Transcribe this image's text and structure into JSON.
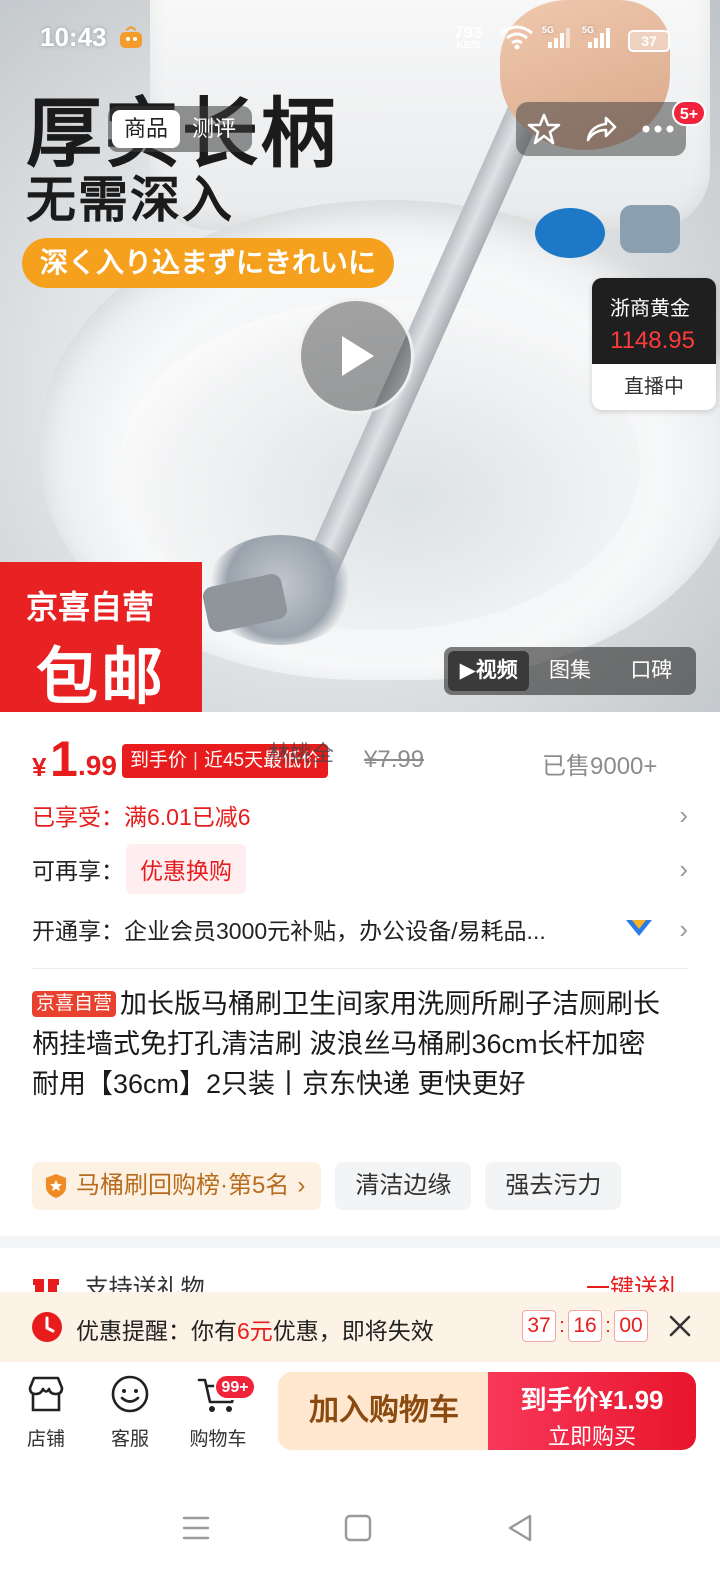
{
  "status_bar": {
    "time": "10:43",
    "net_speed_value": "793",
    "net_speed_unit": "KB/S",
    "battery": "37"
  },
  "hero": {
    "headline_1": "厚实长柄",
    "headline_2": "无需深入",
    "jp_tagline": "深く入り込まずにきれいに",
    "tabs": [
      {
        "label": "商品",
        "active": true
      },
      {
        "label": "测评",
        "active": false
      }
    ],
    "more_badge": "5+",
    "live_card": {
      "name": "浙商黄金",
      "price": "1148.95",
      "status": "直播中"
    },
    "promo_line_1": "京喜自营",
    "promo_line_2": "包邮",
    "media_tabs": [
      {
        "label": "▶视频",
        "active": true
      },
      {
        "label": "图集",
        "active": false
      },
      {
        "label": "口碑",
        "active": false
      }
    ]
  },
  "price": {
    "currency": "¥",
    "integer": "1",
    "decimal": ".99",
    "tag_left": "到手价",
    "tag_right": "近45天最低价",
    "ghost_text": "林姚全",
    "original": "¥7.99",
    "sold": "已售9000+"
  },
  "benefits": [
    {
      "label": "已享受：",
      "value": "满6.01已减6"
    },
    {
      "label": "可再享：",
      "value": "优惠换购"
    },
    {
      "label": "开通享：",
      "value": "企业会员3000元补贴，办公设备/易耗品..."
    }
  ],
  "title": {
    "tag": "京喜自营",
    "text": "加长版马桶刷卫生间家用洗厕所刷子洁厕刷长柄挂墙式免打孔清洁刷 波浪丝马桶刷36cm长杆加密耐用【36cm】2只装丨京东快递 更快更好"
  },
  "chips": {
    "rank": "马桶刷回购榜·第5名",
    "tags": [
      "清洁边缘",
      "强去污力"
    ]
  },
  "gift": {
    "left": "支持送礼物",
    "right": "一键送礼"
  },
  "reminder": {
    "prefix": "优惠提醒：你有",
    "amount": "6元",
    "suffix": "优惠，即将失效",
    "timer": [
      "37",
      "16",
      "00"
    ]
  },
  "bottom_nav": {
    "shop": "店铺",
    "service": "客服",
    "cart": "购物车",
    "cart_badge": "99+",
    "add_to_cart": "加入购物车",
    "buy_price_label": "到手价¥1.99",
    "buy_now": "立即购买"
  },
  "colors": {
    "accent_red": "#e81c1c",
    "promo_orange": "#f5a11e",
    "cart_button_bg": "#ffe8cf"
  }
}
